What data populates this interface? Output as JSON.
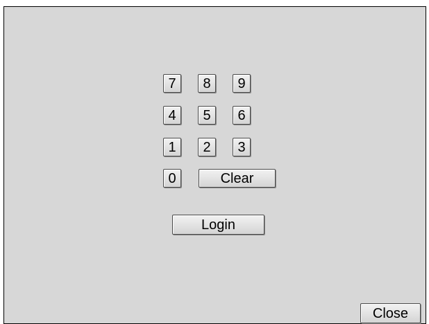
{
  "keypad": {
    "rows": [
      [
        "7",
        "8",
        "9"
      ],
      [
        "4",
        "5",
        "6"
      ],
      [
        "1",
        "2",
        "3"
      ]
    ],
    "zero": "0",
    "clear": "Clear"
  },
  "actions": {
    "login": "Login",
    "close": "Close"
  }
}
